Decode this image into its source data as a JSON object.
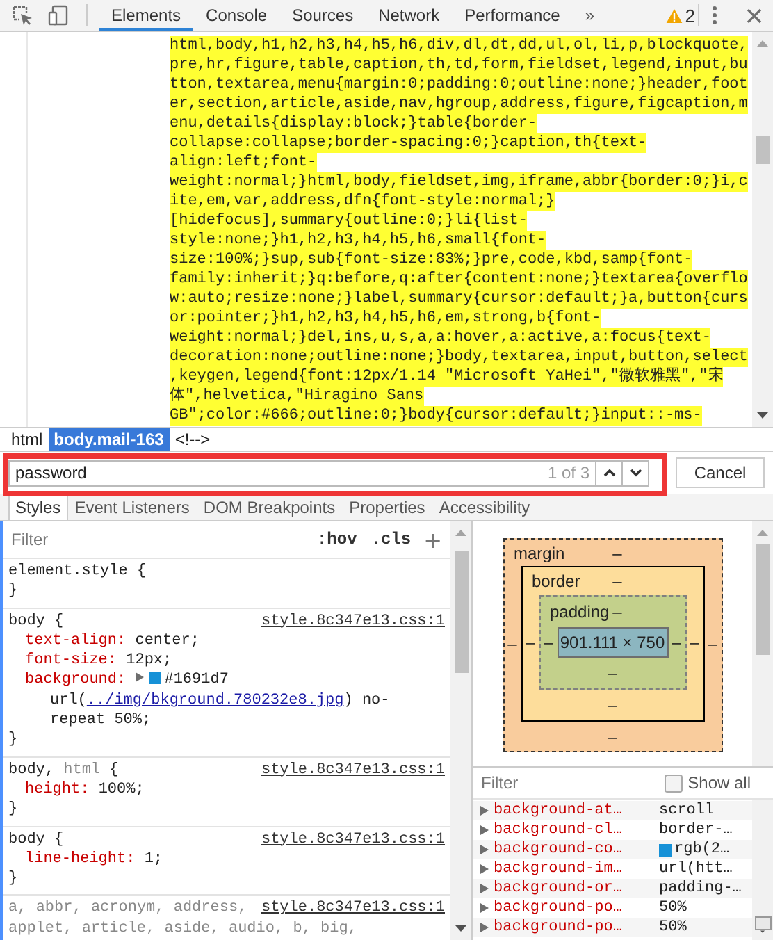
{
  "toolbar": {
    "tabs": [
      {
        "label": "Elements",
        "selected": true
      },
      {
        "label": "Console",
        "selected": false
      },
      {
        "label": "Sources",
        "selected": false
      },
      {
        "label": "Network",
        "selected": false
      },
      {
        "label": "Performance",
        "selected": false
      }
    ],
    "overflow": "»",
    "warnings": "2"
  },
  "code_lines": [
    "html,body,h1,h2,h3,h4,h5,h6,div,dl,dt,dd,ul,ol,li,p,blockquote,",
    "pre,hr,figure,table,caption,th,td,form,fieldset,legend,input,bu",
    "tton,textarea,menu{margin:0;padding:0;outline:none;}header,foot",
    "er,section,article,aside,nav,hgroup,address,figure,figcaption,m",
    "enu,details{display:block;}table{border-",
    "collapse:collapse;border-spacing:0;}caption,th{text-",
    "align:left;font-",
    "weight:normal;}html,body,fieldset,img,iframe,abbr{border:0;}i,c",
    "ite,em,var,address,dfn{font-style:normal;}",
    "[hidefocus],summary{outline:0;}li{list-",
    "style:none;}h1,h2,h3,h4,h5,h6,small{font-",
    "size:100%;}sup,sub{font-size:83%;}pre,code,kbd,samp{font-",
    "family:inherit;}q:before,q:after{content:none;}textarea{overflo",
    "w:auto;resize:none;}label,summary{cursor:default;}a,button{curs",
    "or:pointer;}h1,h2,h3,h4,h5,h6,em,strong,b{font-",
    "weight:normal;}del,ins,u,s,a,a:hover,a:active,a:focus{text-",
    "decoration:none;outline:none;}body,textarea,input,button,select",
    ",keygen,legend{font:12px/1.14 \"Microsoft YaHei\",\"微软雅黑\",\"宋",
    "体\",helvetica,\"Hiragino Sans",
    "GB\";color:#666;outline:0;}body{cursor:default;}input::-ms-"
  ],
  "breadcrumbs": [
    {
      "label": "html",
      "selected": false
    },
    {
      "label": "body.mail-163",
      "selected": true
    },
    {
      "label": "<!-->",
      "selected": false
    }
  ],
  "search": {
    "value": "password",
    "match_count": "1 of 3",
    "cancel": "Cancel"
  },
  "sidebar_tabs": [
    {
      "label": "Styles",
      "selected": true
    },
    {
      "label": "Event Listeners",
      "selected": false
    },
    {
      "label": "DOM Breakpoints",
      "selected": false
    },
    {
      "label": "Properties",
      "selected": false
    },
    {
      "label": "Accessibility",
      "selected": false
    }
  ],
  "styles": {
    "filter_placeholder": "Filter",
    "hov": ":hov",
    "cls": ".cls",
    "add": "+",
    "rules": [
      {
        "selectors": [
          {
            "text": "element.style",
            "matched": true
          }
        ],
        "open": "{",
        "close": "}"
      },
      {
        "selectors": [
          {
            "text": "body",
            "matched": true
          }
        ],
        "open": "{",
        "source": "style.8c347e13.css:1",
        "properties": [
          {
            "name": "text-align:",
            "value": [
              {
                "kind": "text",
                "text": "center;"
              }
            ]
          },
          {
            "name": "font-size:",
            "value": [
              {
                "kind": "text",
                "text": "12px;"
              }
            ]
          },
          {
            "name": "background:",
            "value": [
              {
                "kind": "expander"
              },
              {
                "kind": "swatch",
                "color": "#1691d7"
              },
              {
                "kind": "text",
                "text": "#1691d7 "
              },
              {
                "kind": "link",
                "prefix": "url(",
                "text": "../img/bkground.780232e8.jpg",
                "suffix": ") no-"
              },
              {
                "kind": "text",
                "text": "repeat 50%;"
              }
            ]
          }
        ],
        "close": "}"
      },
      {
        "selectors": [
          {
            "text": "body,",
            "matched": true
          },
          {
            "text": "html",
            "matched": false
          }
        ],
        "open": "{",
        "source": "style.8c347e13.css:1",
        "properties": [
          {
            "name": "height:",
            "value": [
              {
                "kind": "text",
                "text": "100%;"
              }
            ]
          }
        ],
        "close": "}"
      },
      {
        "selectors": [
          {
            "text": "body",
            "matched": true
          }
        ],
        "open": "{",
        "source": "style.8c347e13.css:1",
        "properties": [
          {
            "name": "line-height:",
            "value": [
              {
                "kind": "text",
                "text": "1;"
              }
            ]
          }
        ],
        "close": "}"
      },
      {
        "selectors": [
          {
            "text": "a,",
            "matched": false
          },
          {
            "text": "abbr,",
            "matched": false
          },
          {
            "text": "acronym,",
            "matched": false
          },
          {
            "text": "address,",
            "matched": false
          },
          {
            "text": "applet,",
            "matched": false
          },
          {
            "text": "article,",
            "matched": false
          },
          {
            "text": "aside,",
            "matched": false
          },
          {
            "text": "audio,",
            "matched": false
          },
          {
            "text": "b,",
            "matched": false
          },
          {
            "text": "big,",
            "matched": false
          }
        ],
        "source": "style.8c347e13.css:1"
      }
    ]
  },
  "box_model": {
    "margin": {
      "label": "margin",
      "top": "–",
      "right": "–",
      "bottom": "–",
      "left": "–"
    },
    "border": {
      "label": "border",
      "top": "–",
      "right": "–",
      "bottom": "–",
      "left": "–"
    },
    "padding": {
      "label": "padding",
      "top": "–",
      "right": "–",
      "bottom": "–",
      "left": "–"
    },
    "content": "901.111 × 750"
  },
  "computed": {
    "filter_placeholder": "Filter",
    "show_all": {
      "label": "Show all",
      "checked": false
    },
    "properties": [
      {
        "name": "background-at…",
        "value": "scroll"
      },
      {
        "name": "background-cl…",
        "value": "border-…"
      },
      {
        "name": "background-co…",
        "color": "#1691d7",
        "value": "rgb(2…"
      },
      {
        "name": "background-im…",
        "value": "url(htt…"
      },
      {
        "name": "background-or…",
        "value": "padding-…"
      },
      {
        "name": "background-po…",
        "value": "50%"
      },
      {
        "name": "background-po…",
        "value": "50%"
      }
    ]
  }
}
